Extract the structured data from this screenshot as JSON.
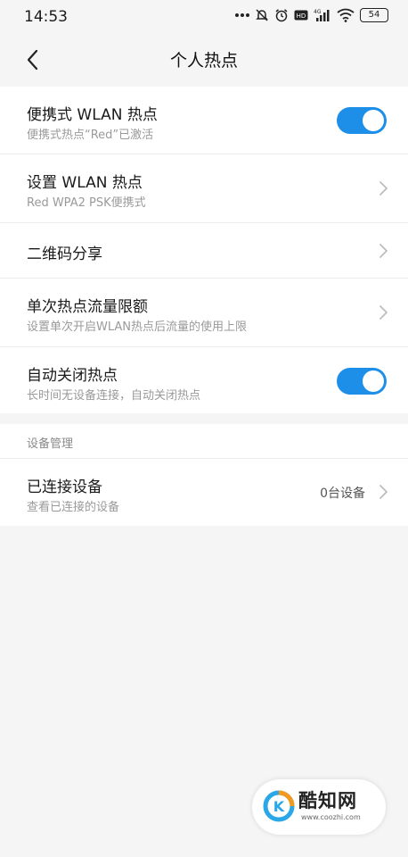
{
  "status_bar": {
    "time": "14:53",
    "network": "4G",
    "battery": "54",
    "icons": [
      "more-dots-icon",
      "mute-icon",
      "alarm-icon",
      "hd-icon",
      "signal-icon",
      "wifi-icon",
      "battery-icon"
    ]
  },
  "header": {
    "title": "个人热点",
    "back_icon": "chevron-left-icon"
  },
  "hotspot_settings": {
    "portable_hotspot": {
      "title": "便携式 WLAN 热点",
      "subtitle": "便携式热点“Red”已激活",
      "enabled": true
    },
    "setup_hotspot": {
      "title": "设置 WLAN 热点",
      "subtitle": "Red WPA2 PSK便携式"
    },
    "qr_share": {
      "title": "二维码分享"
    },
    "data_limit": {
      "title": "单次热点流量限额",
      "subtitle": "设置单次开启WLAN热点后流量的使用上限"
    },
    "auto_off": {
      "title": "自动关闭热点",
      "subtitle": "长时间无设备连接，自动关闭热点",
      "enabled": true
    }
  },
  "device_management": {
    "header": "设备管理",
    "connected_devices": {
      "title": "已连接设备",
      "subtitle": "查看已连接的设备",
      "value": "0台设备"
    }
  },
  "watermark": {
    "name": "酷知网",
    "url": "www.coozhi.com"
  },
  "colors": {
    "accent": "#1e8fe8",
    "background": "#f5f5f5",
    "card": "#ffffff"
  }
}
